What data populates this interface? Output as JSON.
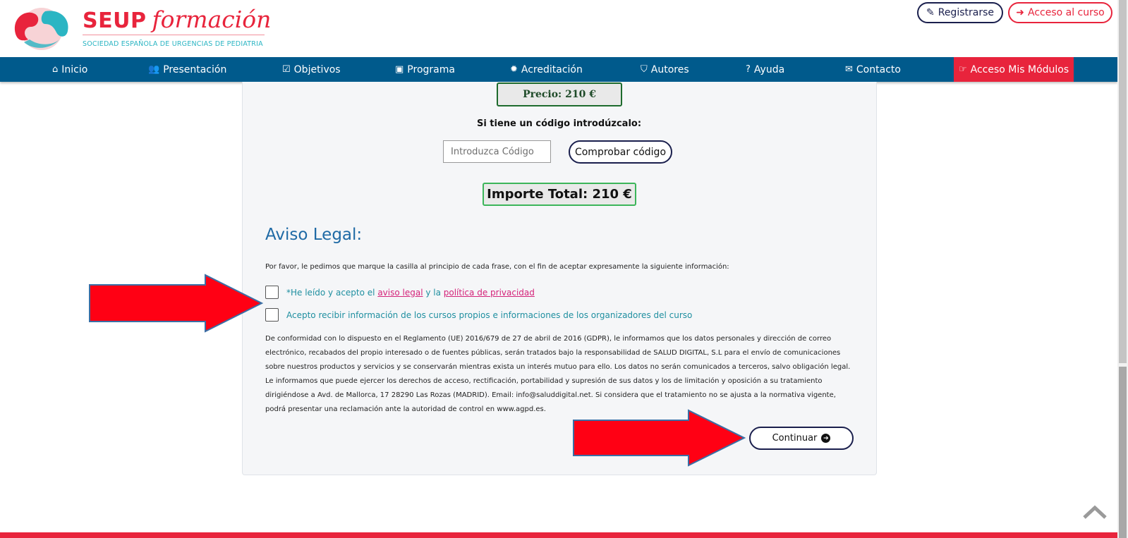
{
  "header": {
    "logo_main": "SEUP",
    "logo_script": "formación",
    "logo_subtitle": "SOCIEDAD ESPAÑOLA DE URGENCIAS DE PEDIATRIA",
    "register_label": "Registrarse",
    "access_label": "Acceso al curso"
  },
  "nav": {
    "items": [
      {
        "label": "Inicio",
        "icon": "home-icon"
      },
      {
        "label": "Presentación",
        "icon": "users-icon"
      },
      {
        "label": "Objetivos",
        "icon": "check-square-icon"
      },
      {
        "label": "Programa",
        "icon": "calendar-check-icon"
      },
      {
        "label": "Acreditación",
        "icon": "certificate-icon"
      },
      {
        "label": "Autores",
        "icon": "shield-icon"
      },
      {
        "label": "Ayuda",
        "icon": "question-circle-icon"
      },
      {
        "label": "Contacto",
        "icon": "envelope-icon"
      },
      {
        "label": "Acceso Mis Módulos",
        "icon": "hand-point-right-icon"
      }
    ]
  },
  "purchase": {
    "price_label": "Precio: 210 €",
    "code_prompt": "Si tiene un código introdúzcalo:",
    "code_placeholder": "Introduzca Código",
    "check_code_label": "Comprobar código",
    "total_label": "Importe Total: 210 €"
  },
  "legal": {
    "title": "Aviso Legal:",
    "intro": "Por favor, le pedimos que marque la casilla al principio de cada frase, con el fin de aceptar expresamente la siguiente información:",
    "check1_prefix": "*He leído y acepto el ",
    "check1_link1": "aviso legal",
    "check1_middle": " y la ",
    "check1_link2": "política de privacidad",
    "check2_text": "Acepto recibir información de los cursos propios e informaciones de los organizadores del curso",
    "gdpr_text": "De conformidad con lo dispuesto en el Reglamento (UE) 2016/679 de 27 de abril de 2016 (GDPR), le informamos que los datos personales y dirección de correo electrónico, recabados del propio interesado o de fuentes públicas, serán tratados bajo la responsabilidad de SALUD DIGITAL, S.L para el envío de comunicaciones sobre nuestros productos y servicios y se conservarán mientras exista un interés mutuo para ello. Los datos no serán comunicados a terceros, salvo obligación legal. Le informamos que puede ejercer los derechos de acceso, rectificación, portabilidad y supresión de sus datos y los de limitación y oposición a su tratamiento dirigiéndose a Avd. de Mallorca, 17 28290 Las Rozas (MADRID). Email: info@saluddigital.net. Si considera que el tratamiento no se ajusta a la normativa vigente, podrá presentar una reclamación ante la autoridad de control en www.agpd.es.",
    "continue_label": "Continuar"
  },
  "colors": {
    "brand_red": "#e8243c",
    "nav_blue": "#005a8c",
    "teal": "#2bb5c3",
    "link_pink": "#d4237a",
    "annotation_arrow": "#ff0014"
  }
}
